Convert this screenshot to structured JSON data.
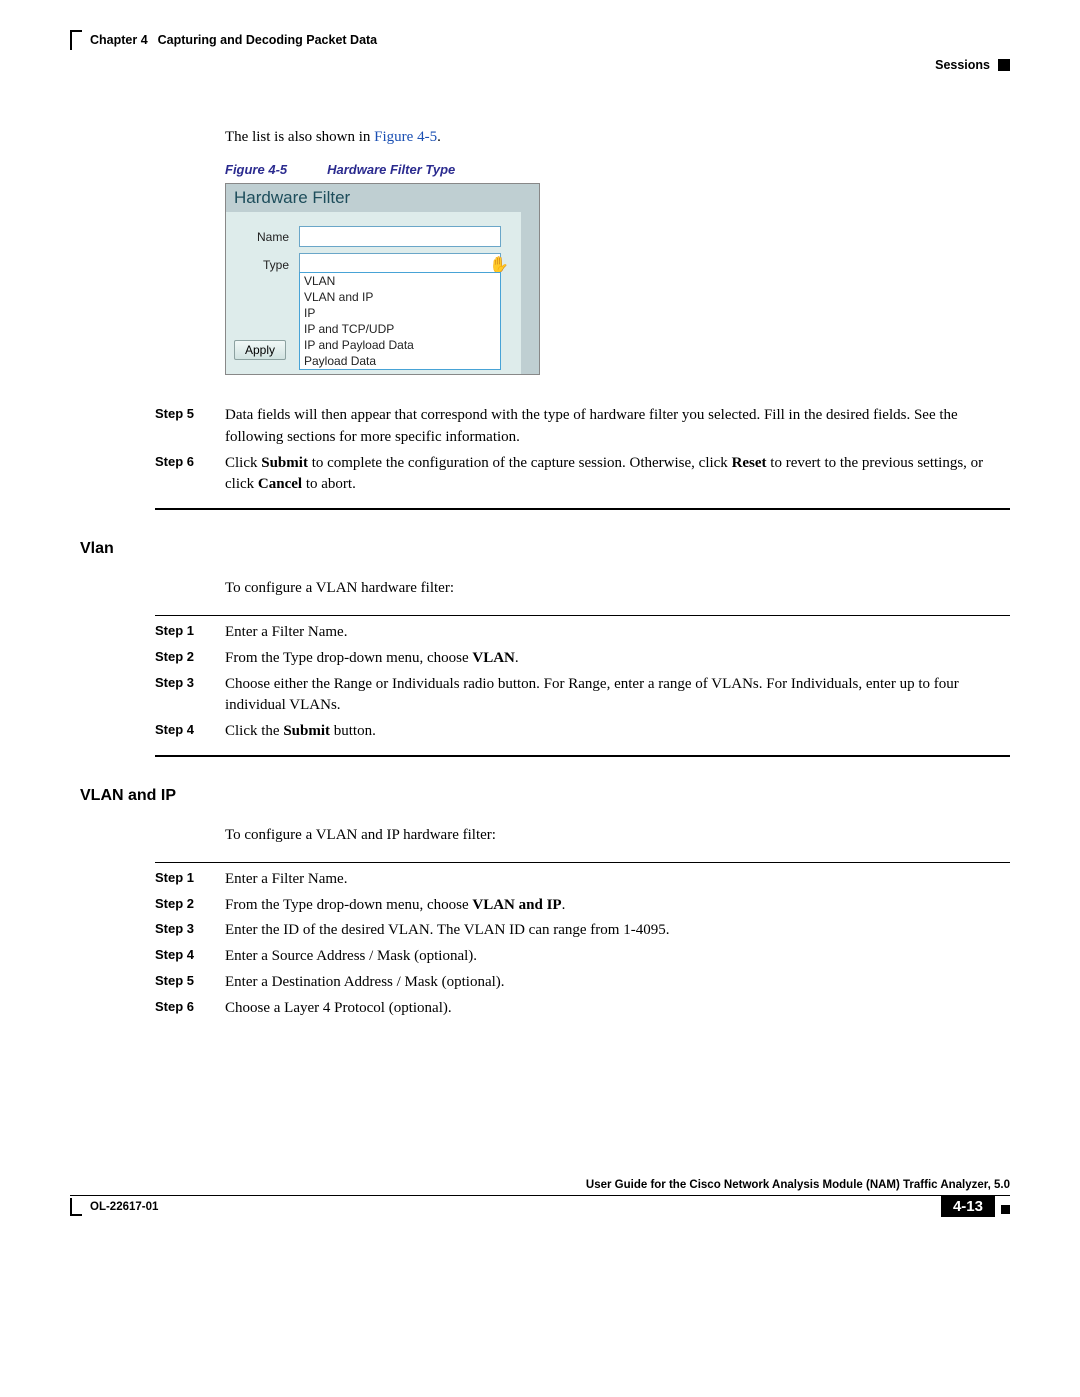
{
  "header": {
    "chapter": "Chapter 4",
    "title": "Capturing and Decoding Packet Data",
    "section": "Sessions"
  },
  "intro_line_prefix": "The list is also shown in ",
  "intro_line_link": "Figure 4-5",
  "intro_line_suffix": ".",
  "figure_caption_num": "Figure 4-5",
  "figure_caption_title": "Hardware Filter Type",
  "hw_filter": {
    "panel_title": "Hardware Filter",
    "name_label": "Name",
    "type_label": "Type",
    "apply_label": "Apply",
    "options": [
      "VLAN",
      "VLAN and IP",
      "IP",
      "IP and TCP/UDP",
      "IP and Payload Data",
      "Payload Data"
    ]
  },
  "steps_a": [
    {
      "label": "Step 5",
      "text_before": "Data fields will then appear that correspond with the type of hardware filter you selected. Fill in the desired fields. See the following sections for more specific information."
    },
    {
      "label": "Step 6",
      "text_before": "Click ",
      "b1": "Submit",
      "mid": " to complete the configuration of the capture session. Otherwise, click ",
      "b2": "Reset",
      "mid2": " to revert to the previous settings, or click ",
      "b3": "Cancel",
      "after": " to abort."
    }
  ],
  "section_vlan": {
    "heading": "Vlan",
    "intro": "To configure a VLAN hardware filter:",
    "steps": [
      {
        "label": "Step 1",
        "text": "Enter a Filter Name."
      },
      {
        "label": "Step 2",
        "pre": "From the Type drop-down menu, choose ",
        "bold": "VLAN",
        "post": "."
      },
      {
        "label": "Step 3",
        "text": "Choose either the Range or Individuals radio button. For Range, enter a range of VLANs. For Individuals, enter up to four individual VLANs."
      },
      {
        "label": "Step 4",
        "pre": "Click the ",
        "bold": "Submit",
        "post": " button."
      }
    ]
  },
  "section_vlanip": {
    "heading": "VLAN and IP",
    "intro": "To configure a VLAN and IP hardware filter:",
    "steps": [
      {
        "label": "Step 1",
        "text": "Enter a Filter Name."
      },
      {
        "label": "Step 2",
        "pre": "From the Type drop-down menu, choose ",
        "bold": "VLAN and IP",
        "post": "."
      },
      {
        "label": "Step 3",
        "text": "Enter the ID of the desired VLAN. The VLAN ID can range from 1-4095."
      },
      {
        "label": "Step 4",
        "text": "Enter a Source Address / Mask (optional)."
      },
      {
        "label": "Step 5",
        "text": "Enter a Destination Address / Mask (optional)."
      },
      {
        "label": "Step 6",
        "text": "Choose a Layer 4 Protocol (optional)."
      }
    ]
  },
  "footer": {
    "guide": "User Guide for the Cisco Network Analysis Module (NAM) Traffic Analyzer, 5.0",
    "doc_id": "OL-22617-01",
    "page": "4-13"
  }
}
